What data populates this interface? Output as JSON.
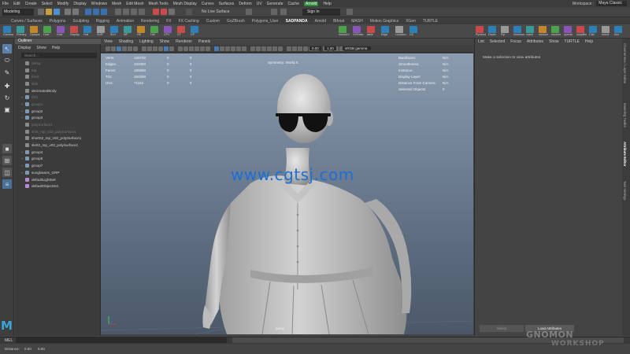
{
  "menubar": {
    "items": [
      "File",
      "Edit",
      "Create",
      "Select",
      "Modify",
      "Display",
      "Windows",
      "Mesh",
      "Edit Mesh",
      "Mesh Tools",
      "Mesh Display",
      "Curves",
      "Surfaces",
      "Deform",
      "UV",
      "Generate",
      "Cache",
      "Arnold",
      "Help"
    ],
    "workspace_label": "Workspace :",
    "workspace_value": "Maya Classic"
  },
  "statusline": {
    "mode": "Modeling",
    "live_surface": "No Live Surface",
    "signin": "Sign In"
  },
  "shelf": {
    "tabs": [
      "Curves / Surfaces",
      "Polygons",
      "Sculpting",
      "Rigging",
      "Animation",
      "Rendering",
      "FX",
      "FX Caching",
      "Custom",
      "GoZBrush",
      "Polygons_User",
      "SADPANDA",
      "Arnold",
      "Bifrost",
      "MASH",
      "Motion Graphics",
      "XGen",
      "TURTLE"
    ],
    "active_tab": "SADPANDA",
    "labels_left": [
      "Camera",
      "Primary",
      "Opaque",
      "Hold",
      "Hold",
      "Display",
      "Hull",
      "SUR",
      "SLH",
      "WF",
      "HS",
      "HW",
      "CPV",
      "VT",
      "CP"
    ],
    "labels_right": [
      "Pyramid",
      "Depth",
      "Pyr",
      "Immerse",
      "crash",
      "random",
      "random",
      "spread",
      "snapBtn",
      "Cab",
      "wreck",
      "blur"
    ],
    "labels_mid": [
      "meshUV",
      "UVRatio",
      "table",
      "Edge",
      "Location",
      "CE"
    ]
  },
  "outliner": {
    "title": "Outliner",
    "menu": [
      "Display",
      "Show",
      "Help"
    ],
    "search_placeholder": "Search...",
    "items": [
      {
        "label": "persp",
        "dim": true,
        "type": "mesh",
        "expand": ""
      },
      {
        "label": "top",
        "dim": true,
        "type": "mesh",
        "expand": ""
      },
      {
        "label": "front",
        "dim": true,
        "type": "mesh",
        "expand": ""
      },
      {
        "label": "side",
        "dim": true,
        "type": "mesh",
        "expand": ""
      },
      {
        "label": "decimatedBody",
        "dim": false,
        "type": "mesh",
        "expand": ""
      },
      {
        "label": "(hs)",
        "dim": true,
        "type": "grp",
        "expand": "+"
      },
      {
        "label": "group1",
        "dim": true,
        "type": "grp",
        "expand": "+"
      },
      {
        "label": "group2",
        "dim": false,
        "type": "grp",
        "expand": "+"
      },
      {
        "label": "group3",
        "dim": false,
        "type": "grp",
        "expand": "+"
      },
      {
        "label": "polySurface1",
        "dim": true,
        "type": "mesh",
        "expand": ""
      },
      {
        "label": "shirt_mp_v03_polySurface1",
        "dim": true,
        "type": "mesh",
        "expand": ""
      },
      {
        "label": "shorts2_mp_v03_polySurface1",
        "dim": false,
        "type": "mesh",
        "expand": ""
      },
      {
        "label": "skirt2_mp_v03_polySurface1",
        "dim": false,
        "type": "mesh",
        "expand": ""
      },
      {
        "label": "group4",
        "dim": false,
        "type": "grp",
        "expand": "+"
      },
      {
        "label": "group6",
        "dim": false,
        "type": "grp",
        "expand": "+"
      },
      {
        "label": "group7",
        "dim": false,
        "type": "grp",
        "expand": "+"
      },
      {
        "label": "sunglasses_GRP",
        "dim": false,
        "type": "grp",
        "expand": "+"
      },
      {
        "label": "defaultLightSet",
        "dim": false,
        "type": "set",
        "expand": ""
      },
      {
        "label": "defaultObjectSet",
        "dim": false,
        "type": "set",
        "expand": ""
      }
    ]
  },
  "viewport": {
    "menu": [
      "View",
      "Shading",
      "Lighting",
      "Show",
      "Renderer",
      "Panels"
    ],
    "num1": "0.00",
    "num2": "1.00",
    "color_space": "sRGB gamma",
    "hud_left": [
      {
        "label": "Verts:",
        "c1": "126732",
        "c2": "0",
        "c3": "0"
      },
      {
        "label": "Edges:",
        "c1": "222360",
        "c2": "0",
        "c3": "0"
      },
      {
        "label": "Faces:",
        "c1": "195960",
        "c2": "0",
        "c3": "0"
      },
      {
        "label": "Tris:",
        "c1": "250288",
        "c2": "0",
        "c3": "0"
      },
      {
        "label": "UVs:",
        "c1": "71164",
        "c2": "0",
        "c3": "0"
      }
    ],
    "symmetry": "Symmetry: World X",
    "hud_right": [
      {
        "label": "Backfaces:",
        "value": "N/A"
      },
      {
        "label": "Smoothness:",
        "value": "N/A"
      },
      {
        "label": "Instance:",
        "value": "N/A"
      },
      {
        "label": "Display Layer:",
        "value": "N/A"
      },
      {
        "label": "Distance From Camera:",
        "value": "N/A"
      },
      {
        "label": "Selected Objects:",
        "value": "0"
      }
    ],
    "camera_name": "persp",
    "watermark": "www.cgtsj.com"
  },
  "attribute_editor": {
    "menu": [
      "List",
      "Selected",
      "Focus",
      "Attributes",
      "Show",
      "TURTLE",
      "Help"
    ],
    "message": "Make a selection to view attributes",
    "select_button": "Select",
    "load_button": "Load Attributes"
  },
  "side_tabs": [
    "Channel Box / Layer Editor",
    "Modeling Toolkit",
    "Attribute Editor",
    "Tool Settings"
  ],
  "side_tab_active": "Attribute Editor",
  "commandline": {
    "label": "MEL"
  },
  "helpline": {
    "label": "Distance:",
    "v1": "0.00",
    "v2": "0.00"
  },
  "brand_watermark": {
    "line1": "GNOMON",
    "line2": "WORKSHOP"
  }
}
